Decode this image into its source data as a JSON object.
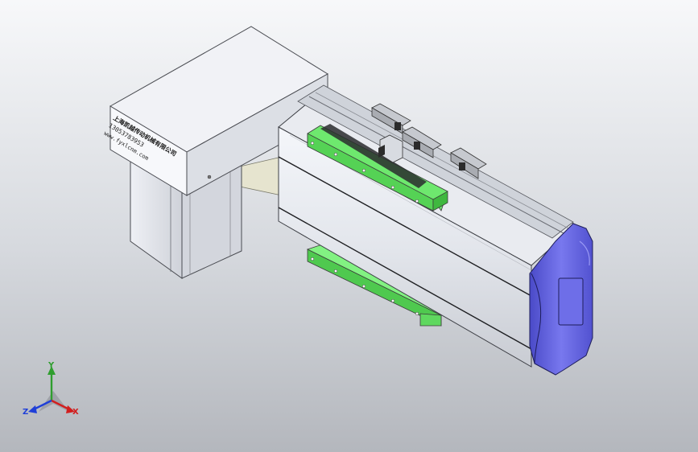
{
  "model": {
    "motor_label": {
      "company": "上海凯越传动机械有限公司",
      "phone": "13053783953",
      "website": "www.fyxlcnm.com"
    }
  },
  "triad": {
    "x_label": "X",
    "y_label": "Y",
    "z_label": "Z",
    "x_color": "#d21e1e",
    "y_color": "#2f9e2f",
    "z_color": "#1f3fd8"
  },
  "colors": {
    "actuator_body": "#e6e9ef",
    "end_cap": "#6b6be0",
    "mount_block": "#63e863",
    "motor_housing": "#dfe2e9"
  }
}
